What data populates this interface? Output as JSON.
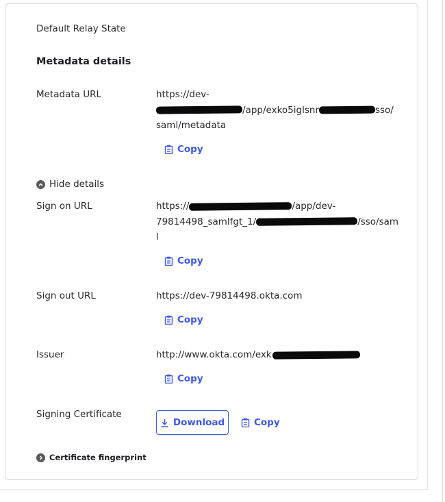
{
  "relay_state_label": "Default Relay State",
  "metadata_heading": "Metadata details",
  "metadata_url": {
    "label": "Metadata URL",
    "line1": "https://dev-",
    "line2_mid": "/app/exko5iglsnr",
    "line2_end": "sso/",
    "line3": "saml/metadata",
    "copy": "Copy"
  },
  "hide_details": "Hide details",
  "sign_on_url": {
    "label": "Sign on URL",
    "line1_start": "https://",
    "line1_end": "/app/dev-",
    "line2_start": "79814498_samlfgt_1/",
    "line2_end": "/sso/sam",
    "line3": "l",
    "copy": "Copy"
  },
  "sign_out_url": {
    "label": "Sign out URL",
    "value": "https://dev-79814498.okta.com",
    "copy": "Copy"
  },
  "issuer": {
    "label": "Issuer",
    "value": "http://www.okta.com/exk",
    "copy": "Copy"
  },
  "signing_certificate": {
    "label": "Signing Certificate",
    "download": "Download",
    "copy": "Copy"
  },
  "certificate_fingerprint": "Certificate fingerprint",
  "colors": {
    "accent": "#3f59e4",
    "text": "#2a2a2e",
    "border": "#d7d7dc",
    "redaction": "#0a0a0a"
  },
  "icons": {
    "copy": "clipboard-icon",
    "download": "download-icon",
    "collapse": "chevron-up-circle-icon",
    "expand": "chevron-right-circle-icon"
  }
}
